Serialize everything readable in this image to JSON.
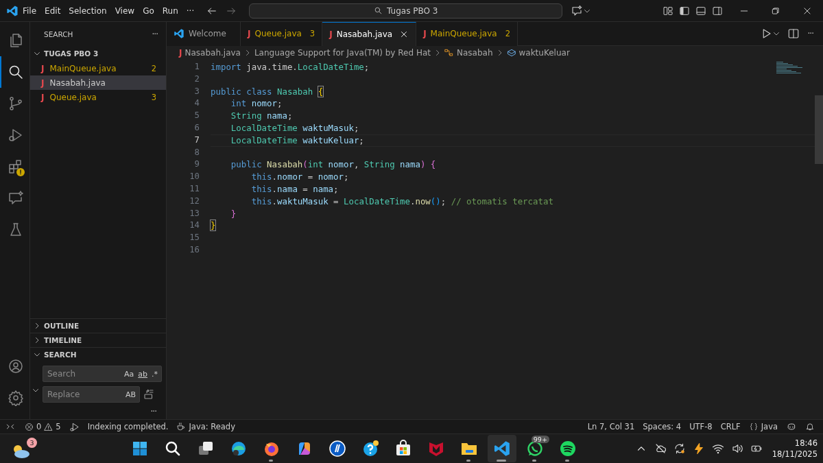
{
  "title_bar": {
    "menu": [
      "File",
      "Edit",
      "Selection",
      "View",
      "Go",
      "Run"
    ],
    "more": "···",
    "search": "Tugas PBO 3"
  },
  "activity_bar": {
    "items": [
      {
        "selected": false,
        "warning": false
      },
      {
        "selected": true,
        "warning": false
      },
      {
        "selected": false,
        "warning": false
      },
      {
        "selected": false,
        "warning": false
      },
      {
        "selected": false,
        "warning": true
      },
      {
        "selected": false,
        "warning": false
      },
      {
        "selected": false,
        "warning": false
      }
    ]
  },
  "sidebar": {
    "title": "SEARCH",
    "more": "···",
    "folder": {
      "name": "TUGAS PBO 3",
      "expanded": true,
      "files": [
        {
          "icon": "J",
          "name": "MainQueue.java",
          "problems": "2",
          "selected": false
        },
        {
          "icon": "J",
          "name": "Nasabah.java",
          "selected": true
        },
        {
          "icon": "J",
          "name": "Queue.java",
          "problems": "3",
          "selected": false
        }
      ]
    },
    "sections": [
      {
        "name": "OUTLINE",
        "expanded": false
      },
      {
        "name": "TIMELINE",
        "expanded": false
      },
      {
        "name": "SEARCH",
        "expanded": true
      }
    ],
    "search": {
      "placeholder": "Search",
      "options": [
        "Aa",
        "ab",
        ".*"
      ],
      "replace_placeholder": "Replace",
      "replace_option": "AB",
      "more": "···"
    }
  },
  "tabs": [
    {
      "kind": "welcome",
      "label": "Welcome",
      "selected": false
    },
    {
      "kind": "file",
      "icon": "J",
      "label": "Queue.java",
      "problems": "3",
      "selected": false
    },
    {
      "kind": "file",
      "icon": "J",
      "label": "Nasabah.java",
      "selected": true
    },
    {
      "kind": "file",
      "icon": "J",
      "label": "MainQueue.java",
      "problems": "2",
      "selected": false
    }
  ],
  "breadcrumbs": [
    {
      "kind": "file",
      "icon": "J",
      "label": "Nasabah.java"
    },
    {
      "kind": "text",
      "label": "Language Support for Java(TM) by Red Hat"
    },
    {
      "kind": "class",
      "label": "Nasabah"
    },
    {
      "kind": "field",
      "label": "waktuKeluar"
    }
  ],
  "editor": {
    "lines": [
      {
        "number": "1",
        "current": false,
        "tokens": [
          {
            "kind": "keyword",
            "text": "import"
          },
          {
            "kind": "plain",
            "text": " java.time."
          },
          {
            "kind": "type",
            "text": "LocalDateTime"
          },
          {
            "kind": "plain",
            "text": ";"
          }
        ]
      },
      {
        "number": "2",
        "current": false
      },
      {
        "number": "3",
        "current": false,
        "tokens": [
          {
            "kind": "keyword",
            "text": "public class"
          },
          {
            "kind": "type",
            "text": " Nasabah "
          },
          {
            "kind": "match",
            "text": "{"
          }
        ]
      },
      {
        "number": "4",
        "current": false,
        "tokens": [
          {
            "kind": "keyword",
            "text": "    int"
          },
          {
            "kind": "variable",
            "text": " nomor"
          },
          {
            "kind": "plain",
            "text": ";"
          }
        ]
      },
      {
        "number": "5",
        "current": false,
        "tokens": [
          {
            "kind": "type",
            "text": "    String"
          },
          {
            "kind": "variable",
            "text": " nama"
          },
          {
            "kind": "plain",
            "text": ";"
          }
        ]
      },
      {
        "number": "6",
        "current": false,
        "tokens": [
          {
            "kind": "type",
            "text": "    LocalDateTime"
          },
          {
            "kind": "variable",
            "text": " waktuMasuk"
          },
          {
            "kind": "plain",
            "text": ";"
          }
        ]
      },
      {
        "number": "7",
        "current": true,
        "tokens": [
          {
            "kind": "type",
            "text": "    LocalDateTime"
          },
          {
            "kind": "variable",
            "text": " waktuKeluar"
          },
          {
            "kind": "plain",
            "text": ";"
          }
        ]
      },
      {
        "number": "8",
        "current": false
      },
      {
        "number": "9",
        "current": false,
        "tokens": [
          {
            "kind": "keyword",
            "text": "    public"
          },
          {
            "kind": "function",
            "text": " Nasabah"
          },
          {
            "kind": "bracket2",
            "text": "("
          },
          {
            "kind": "type",
            "text": "int"
          },
          {
            "kind": "variable",
            "text": " nomor"
          },
          {
            "kind": "plain",
            "text": ", "
          },
          {
            "kind": "type",
            "text": "String"
          },
          {
            "kind": "variable",
            "text": " nama"
          },
          {
            "kind": "bracket2",
            "text": ") {"
          }
        ]
      },
      {
        "number": "10",
        "current": false,
        "tokens": [
          {
            "kind": "keyword",
            "text": "        this"
          },
          {
            "kind": "plain",
            "text": "."
          },
          {
            "kind": "variable",
            "text": "nomor"
          },
          {
            "kind": "plain",
            "text": " = "
          },
          {
            "kind": "variable",
            "text": "nomor"
          },
          {
            "kind": "plain",
            "text": ";"
          }
        ]
      },
      {
        "number": "11",
        "current": false,
        "tokens": [
          {
            "kind": "keyword",
            "text": "        this"
          },
          {
            "kind": "plain",
            "text": "."
          },
          {
            "kind": "variable",
            "text": "nama"
          },
          {
            "kind": "plain",
            "text": " = "
          },
          {
            "kind": "variable",
            "text": "nama"
          },
          {
            "kind": "plain",
            "text": ";"
          }
        ]
      },
      {
        "number": "12",
        "current": false,
        "tokens": [
          {
            "kind": "keyword",
            "text": "        this"
          },
          {
            "kind": "plain",
            "text": "."
          },
          {
            "kind": "variable",
            "text": "waktuMasuk"
          },
          {
            "kind": "plain",
            "text": " = "
          },
          {
            "kind": "type",
            "text": "LocalDateTime"
          },
          {
            "kind": "plain",
            "text": "."
          },
          {
            "kind": "function",
            "text": "now"
          },
          {
            "kind": "bracket3",
            "text": "()"
          },
          {
            "kind": "plain",
            "text": "; "
          },
          {
            "kind": "comment",
            "text": "// otomatis tercatat"
          }
        ]
      },
      {
        "number": "13",
        "current": false,
        "tokens": [
          {
            "kind": "bracket2",
            "text": "    }"
          }
        ]
      },
      {
        "number": "14",
        "current": false,
        "tokens": [
          {
            "kind": "match",
            "text": "}"
          }
        ]
      },
      {
        "number": "15",
        "current": false
      },
      {
        "number": "16",
        "current": false
      }
    ]
  },
  "status_bar": {
    "errors": "0",
    "warnings": "5",
    "message": "Indexing completed.",
    "java_status": "Java: Ready",
    "position": "Ln 7, Col 31",
    "indent": "Spaces: 4",
    "encoding": "UTF-8",
    "line_ending": "CRLF",
    "language": "Java"
  },
  "taskbar": {
    "weather_badge": "3",
    "apps": [
      {
        "running": false,
        "selected": false
      },
      {
        "running": false,
        "selected": false
      },
      {
        "running": false,
        "selected": false
      },
      {
        "running": false,
        "selected": false
      },
      {
        "running": true,
        "selected": false
      },
      {
        "running": false,
        "selected": false
      },
      {
        "running": false,
        "selected": false
      },
      {
        "running": false,
        "selected": false
      },
      {
        "running": false,
        "selected": false
      },
      {
        "running": false,
        "selected": false
      },
      {
        "running": true,
        "selected": false
      },
      {
        "running": true,
        "selected": true
      },
      {
        "running": true,
        "selected": false,
        "badge": "99+"
      },
      {
        "running": true,
        "selected": false
      }
    ],
    "time": "18:46",
    "date": "18/11/2025"
  }
}
